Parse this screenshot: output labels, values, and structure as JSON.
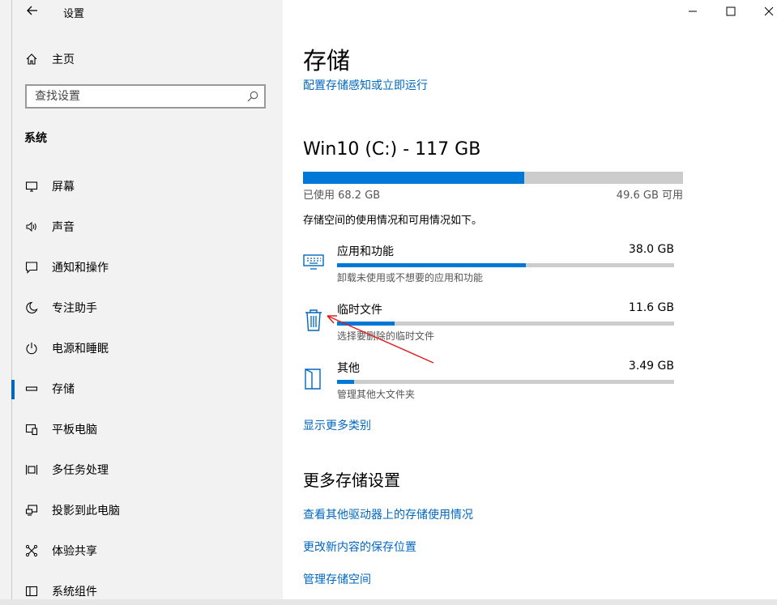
{
  "app": {
    "title": "设置"
  },
  "nav": {
    "home_label": "主页",
    "search_placeholder": "查找设置",
    "section_title": "系统",
    "items": [
      {
        "label": "屏幕",
        "icon": "monitor-icon"
      },
      {
        "label": "声音",
        "icon": "speaker-icon"
      },
      {
        "label": "通知和操作",
        "icon": "notification-icon"
      },
      {
        "label": "专注助手",
        "icon": "moon-icon"
      },
      {
        "label": "电源和睡眠",
        "icon": "power-icon"
      },
      {
        "label": "存储",
        "icon": "storage-icon",
        "active": true
      },
      {
        "label": "平板电脑",
        "icon": "tablet-icon"
      },
      {
        "label": "多任务处理",
        "icon": "multitask-icon"
      },
      {
        "label": "投影到此电脑",
        "icon": "project-icon"
      },
      {
        "label": "体验共享",
        "icon": "share-icon"
      },
      {
        "label": "系统组件",
        "icon": "components-icon"
      }
    ]
  },
  "main": {
    "title": "存储",
    "config_link": "配置存储感知或立即运行",
    "drive": {
      "title": "Win10 (C:) - 117 GB",
      "used_label": "已使用 68.2 GB",
      "free_label": "49.6 GB 可用",
      "used_fraction": 0.583
    },
    "description": "存储空间的使用情况和可用情况如下。",
    "categories": [
      {
        "name": "应用和功能",
        "size": "38.0 GB",
        "sub": "卸载未使用或不想要的应用和功能",
        "fraction": 0.56,
        "icon": "apps-icon"
      },
      {
        "name": "临时文件",
        "size": "11.6 GB",
        "sub": "选择要删除的临时文件",
        "fraction": 0.17,
        "icon": "trash-icon"
      },
      {
        "name": "其他",
        "size": "3.49 GB",
        "sub": "管理其他大文件夹",
        "fraction": 0.05,
        "icon": "folder-icon"
      }
    ],
    "show_more_link": "显示更多类别",
    "more_title": "更多存储设置",
    "more_links": [
      "查看其他驱动器上的存储使用情况",
      "更改新内容的保存位置",
      "管理存储空间"
    ]
  },
  "colors": {
    "accent": "#0078d7",
    "link": "#0067c0",
    "annotation_arrow": "#e02020"
  }
}
